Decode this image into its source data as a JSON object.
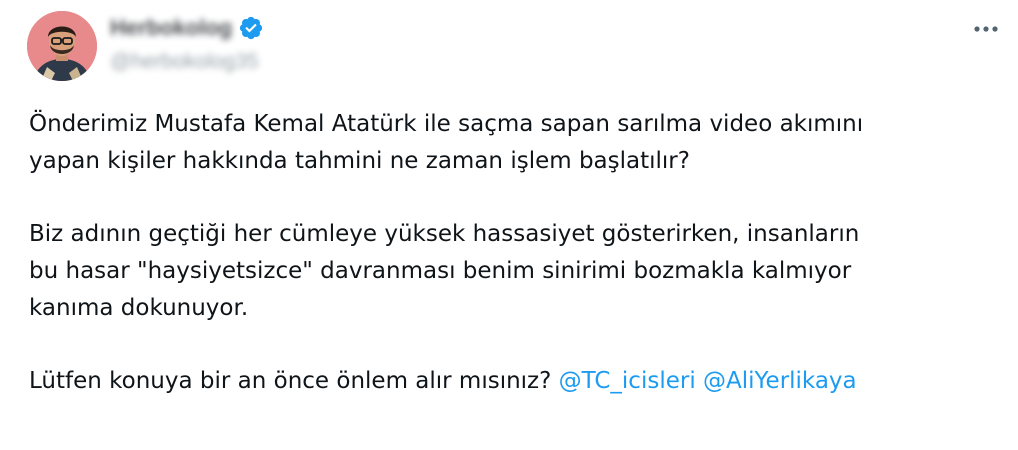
{
  "tweet": {
    "author": {
      "display_name": "Herbokolog",
      "handle": "@herbokolog35",
      "verified_icon": "verified-badge-icon",
      "verified_color": "#1d9bf0"
    },
    "more_icon": "more-horizontal-icon",
    "paragraph1": {
      "line1": "Önderimiz Mustafa Kemal Atatürk ile saçma sapan sarılma video akımını",
      "line2": "yapan kişiler hakkında tahmini ne zaman işlem başlatılır?"
    },
    "paragraph2": {
      "line1": "Biz adının geçtiği her cümleye yüksek hassasiyet gösterirken, insanların",
      "line2": "bu hasar \"haysiyetsizce\" davranması benim sinirimi bozmakla kalmıyor",
      "line3": "kanıma dokunuyor."
    },
    "paragraph3": {
      "text": "Lütfen konuya bir an önce önlem alır mısınız?",
      "mention1": "@TC_icisleri",
      "mention2": "@AliYerlikaya"
    },
    "colors": {
      "text": "#0f1419",
      "link": "#1d9bf0",
      "secondary": "#536471"
    }
  }
}
